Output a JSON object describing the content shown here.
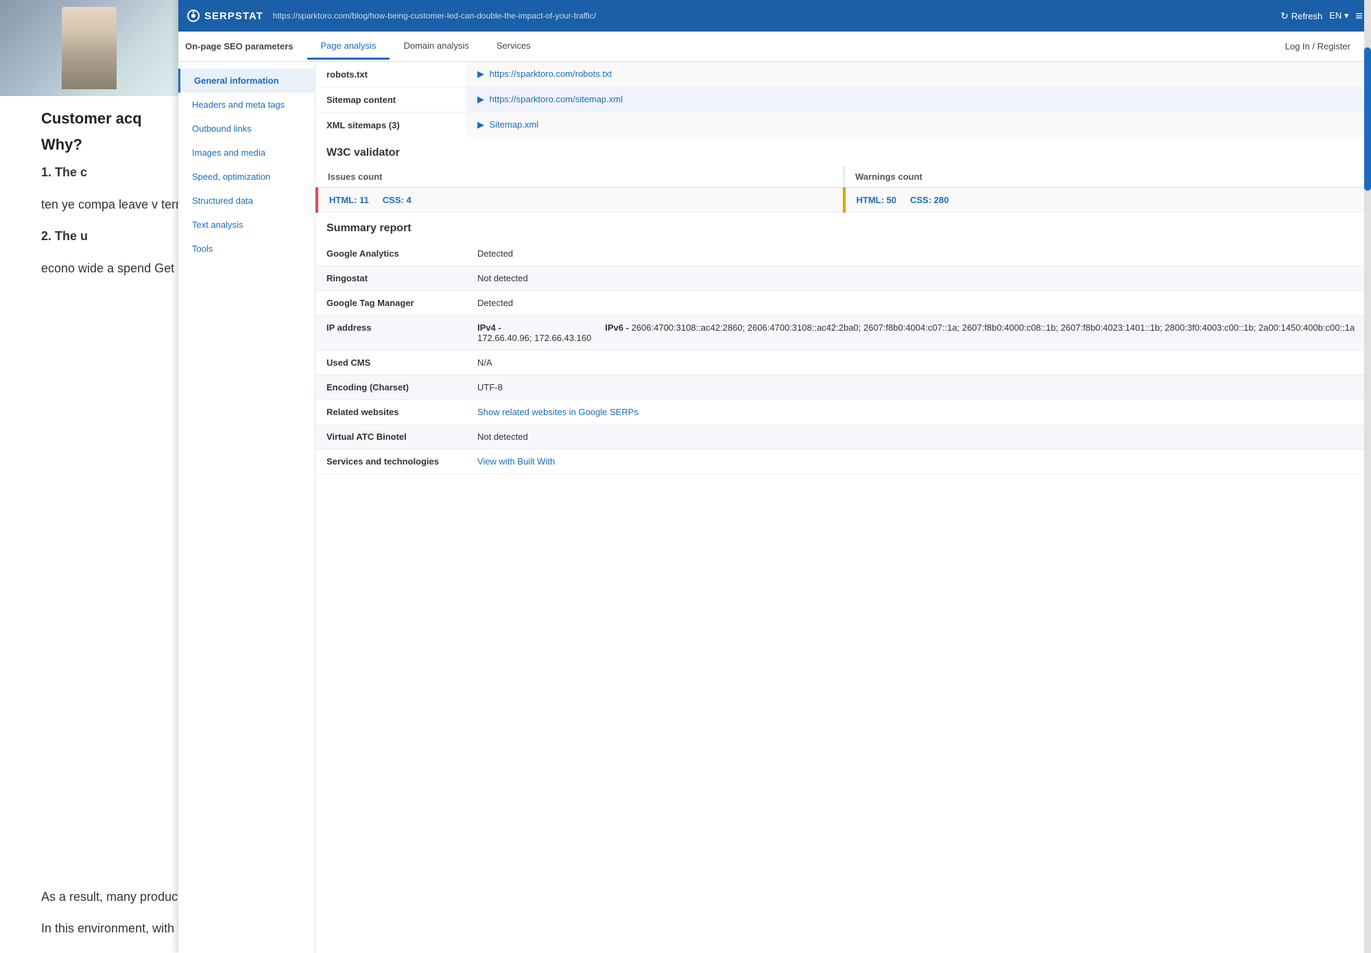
{
  "blog": {
    "bg_text_1": "Customer acq",
    "bg_text_2": "Why?",
    "bg_numbered_1": "1. The c",
    "bg_numbered_1_body": "ten ye compa leave v term i",
    "bg_numbered_2": "2. The u",
    "bg_numbered_2_body": "econo wide a spend Get ri",
    "bottom_text_1": "As a result, many products are experiencing a simultaneous slowdown in new sales and record-high customer cancellations.",
    "bottom_text_2": "In this environment, with top of funnel conversion more competitive than ever and higher churn rates than ever, even those lucky companies are feeling their subpar"
  },
  "header": {
    "logo_text": "SERPSTAT",
    "url": "https://sparktoro.com/blog/how-being-customer-led-can-double-the-impact-of-your-traffic/",
    "refresh_label": "Refresh",
    "lang": "EN",
    "lang_arrow": "▾"
  },
  "nav": {
    "left_label": "On-page SEO parameters",
    "tabs": [
      {
        "label": "Page analysis",
        "active": true
      },
      {
        "label": "Domain analysis",
        "active": false
      },
      {
        "label": "Services",
        "active": false
      }
    ],
    "right_tab": "Log In / Register"
  },
  "sidebar": {
    "items": [
      {
        "label": "General information",
        "active": true
      },
      {
        "label": "Headers and meta tags",
        "active": false
      },
      {
        "label": "Outbound links",
        "active": false
      },
      {
        "label": "Images and media",
        "active": false
      },
      {
        "label": "Speed, optimization",
        "active": false
      },
      {
        "label": "Structured data",
        "active": false
      },
      {
        "label": "Text analysis",
        "active": false
      },
      {
        "label": "Tools",
        "active": false
      }
    ]
  },
  "content": {
    "site_files": {
      "rows": [
        {
          "label": "robots.txt",
          "link": "https://sparktoro.com/robots.txt",
          "link_href": "https://sparktoro.com/robots.txt"
        },
        {
          "label": "Sitemap content",
          "link": "https://sparktoro.com/sitemap.xml",
          "link_href": "https://sparktoro.com/sitemap.xml"
        },
        {
          "label": "XML sitemaps (3)",
          "link": "Sitemap.xml",
          "link_href": "#"
        }
      ]
    },
    "w3c": {
      "title": "W3C validator",
      "issues_label": "Issues count",
      "warnings_label": "Warnings count",
      "html_issues": "HTML: 11",
      "css_issues": "CSS: 4",
      "html_warnings": "HTML: 50",
      "css_warnings": "CSS: 280"
    },
    "summary": {
      "title": "Summary report",
      "rows": [
        {
          "label": "Google Analytics",
          "value": "Detected"
        },
        {
          "label": "Ringostat",
          "value": "Not detected"
        },
        {
          "label": "Google Tag Manager",
          "value": "Detected"
        },
        {
          "label": "IP address",
          "ipv4_label": "IPv4 -",
          "ipv4_values": "172.66.40.96; 172.66.43.160",
          "ipv6_label": "IPv6 -",
          "ipv6_values": "2606:4700:3108::ac42:2860; 2606:4700:3108::ac42:2ba0; 2607:f8b0:4004:c07::1a; 2607:f8b0:4000:c08::1b; 2607:f8b0:4023:1401::1b; 2800:3f0:4003:c00::1b; 2a00:1450:400b:c00::1a"
        },
        {
          "label": "Used CMS",
          "value": "N/A"
        },
        {
          "label": "Encoding (Charset)",
          "value": "UTF-8"
        },
        {
          "label": "Related websites",
          "link": "Show related websites in Google SERPs",
          "link_href": "#"
        },
        {
          "label": "Virtual ATC Binotel",
          "value": "Not detected"
        },
        {
          "label": "Services and technologies",
          "link": "View with Built With",
          "link_href": "#"
        }
      ]
    }
  }
}
